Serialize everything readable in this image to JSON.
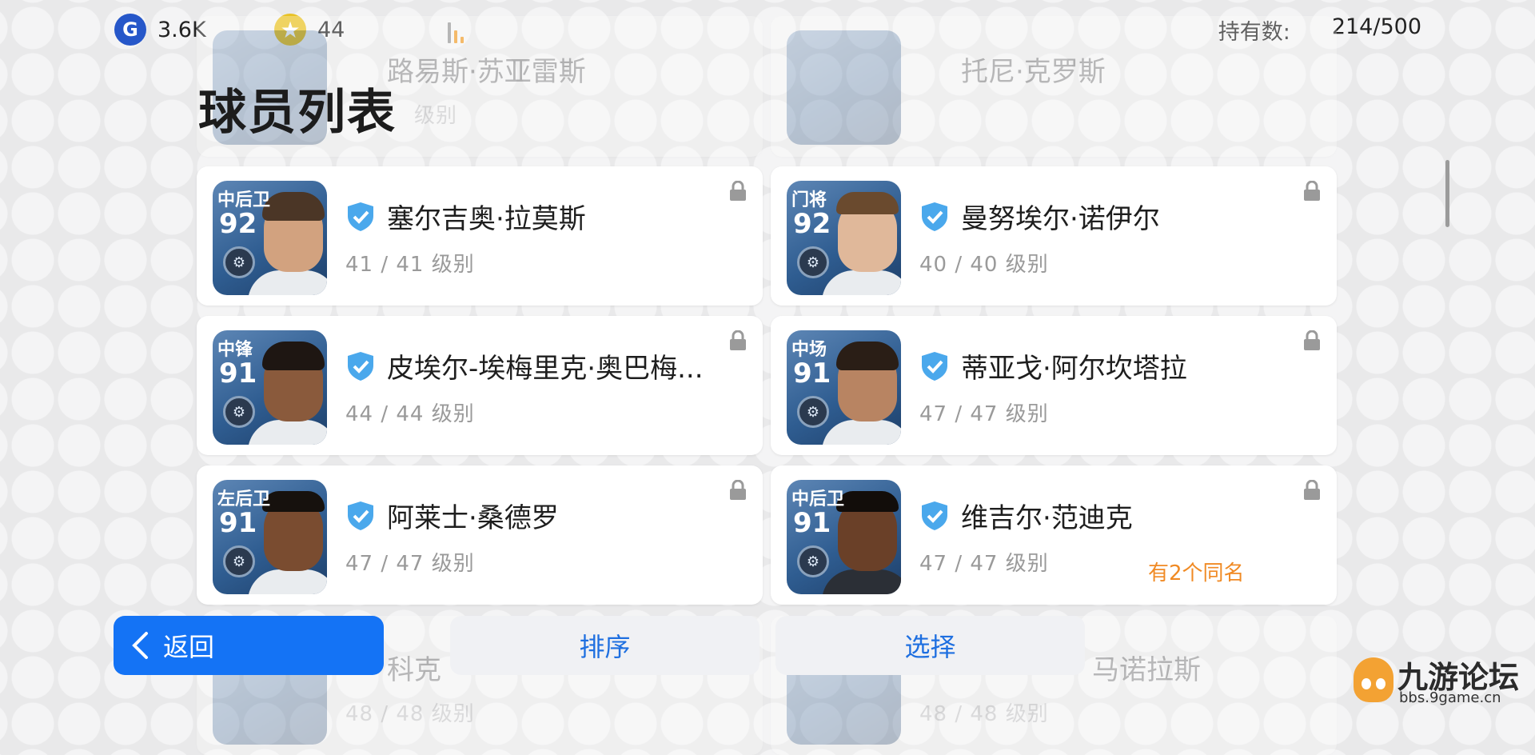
{
  "topbar": {
    "gp": {
      "icon": "gp-coin-icon",
      "value": "3.6K"
    },
    "coins": {
      "icon": "star-coin-icon",
      "value": "44"
    },
    "owned": {
      "label": "持有数:",
      "value": "214/500"
    }
  },
  "page_title": "球员列表",
  "ghost_top": [
    {
      "name": "路易斯·苏亚雷斯",
      "level_suffix": "级别"
    },
    {
      "name": "托尼·克罗斯"
    }
  ],
  "players": [
    {
      "position": "中后卫",
      "rating": "92",
      "name": "塞尔吉奥·拉莫斯",
      "level": "41 / 41 级别",
      "note": ""
    },
    {
      "position": "门将",
      "rating": "92",
      "name": "曼努埃尔·诺伊尔",
      "level": "40 / 40 级别",
      "note": ""
    },
    {
      "position": "中锋",
      "rating": "91",
      "name": "皮埃尔-埃梅里克·奥巴梅...",
      "level": "44 / 44 级别",
      "note": ""
    },
    {
      "position": "中场",
      "rating": "91",
      "name": "蒂亚戈·阿尔坎塔拉",
      "level": "47 / 47 级别",
      "note": ""
    },
    {
      "position": "左后卫",
      "rating": "91",
      "name": "阿莱士·桑德罗",
      "level": "47 / 47 级别",
      "note": ""
    },
    {
      "position": "中后卫",
      "rating": "91",
      "name": "维吉尔·范迪克",
      "level": "47 / 47 级别",
      "note": "有2个同名"
    }
  ],
  "ghost_bottom": [
    {
      "name": "科克",
      "level": "48 / 48 级别"
    },
    {
      "name": "马诺拉斯",
      "level": "48 / 48 级别"
    }
  ],
  "buttons": {
    "back": "返回",
    "sort": "排序",
    "select": "选择"
  },
  "watermark": {
    "title": "九游论坛",
    "url": "bbs.9game.cn"
  },
  "colors": {
    "accent": "#1473f5",
    "note": "#f08a24",
    "card_blue": "#2f5d91"
  }
}
